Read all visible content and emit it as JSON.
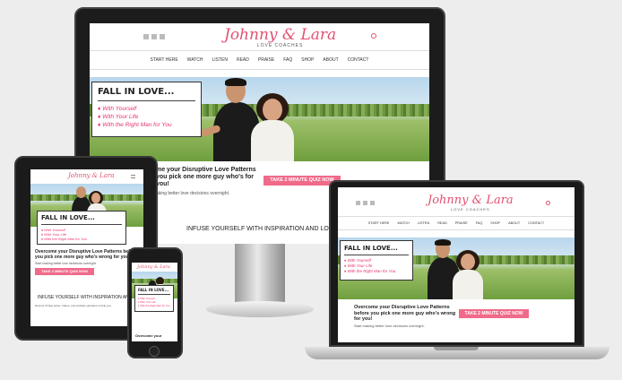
{
  "brand": {
    "logo": "Johnny & Lara",
    "tagline": "LOVE COACHES",
    "accent": "#e2506f",
    "button_color": "#f06a8a"
  },
  "social_icons": [
    "facebook-icon",
    "youtube-icon",
    "google-plus-icon"
  ],
  "nav": [
    "START HERE",
    "WATCH",
    "LISTEN",
    "READ",
    "PRAISE",
    "FAQ",
    "SHOP",
    "ABOUT",
    "CONTACT"
  ],
  "hero": {
    "title": "FALL IN LOVE...",
    "items": [
      "With Yourself",
      "With Your Life",
      "With the Right Man for You"
    ]
  },
  "cta": {
    "headline": "Overcome your Disruptive Love Patterns before you pick one more guy who's wrong for you!",
    "headline_desktop": "me your Disruptive Love Patterns you pick one more guy who's for you!",
    "headline_tablet": "Overcome your Disruptive Love Patterns before you pick one more guy who's wrong for you!",
    "headline_phone": "Overcome your",
    "sub": "Start making better love decisions overnight.",
    "sub_desktop": "aking better love decisions overnight.",
    "button": "TAKE 2 MINUTE QUIZ NOW"
  },
  "section": {
    "title": "INFUSE YOURSELF WITH INSPIRATION AND LOVE",
    "title_tablet": "INFUSE YOURSELF WITH INSPIRATION AND LO",
    "sub_tablet": "Dozens of blog posts, videos, and podcast episodes to help you..."
  }
}
